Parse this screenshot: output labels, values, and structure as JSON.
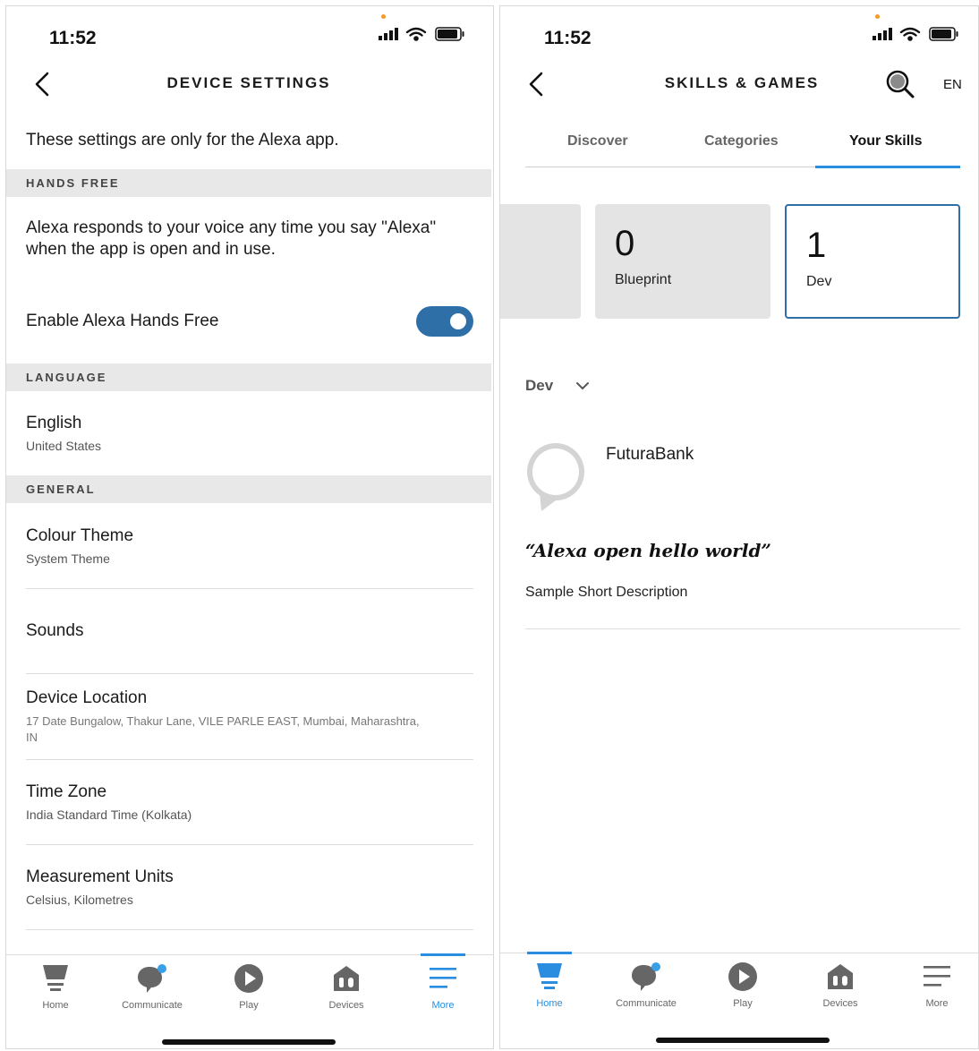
{
  "left": {
    "status": {
      "time": "11:52"
    },
    "header": {
      "title": "DEVICE SETTINGS"
    },
    "intro": "These settings are only for the Alexa app.",
    "hands_free": {
      "section": "HANDS FREE",
      "description": "Alexa responds to your voice any time you say \"Alexa\" when the app is open and in use.",
      "toggle_label": "Enable Alexa Hands Free",
      "toggle_on": true
    },
    "language": {
      "section": "LANGUAGE",
      "title": "English",
      "sub": "United States"
    },
    "general": {
      "section": "GENERAL",
      "items": [
        {
          "title": "Colour Theme",
          "sub": "System Theme"
        },
        {
          "title": "Sounds",
          "sub": ""
        },
        {
          "title": "Device Location",
          "sub": "17 Date Bungalow, Thakur Lane, VILE PARLE EAST, Mumbai, Maharashtra,",
          "sub2": "IN"
        },
        {
          "title": "Time Zone",
          "sub": "India Standard Time (Kolkata)"
        },
        {
          "title": "Measurement Units",
          "sub": "Celsius, Kilometres"
        }
      ]
    },
    "tabbar": [
      {
        "label": "Home",
        "icon": "home-icon"
      },
      {
        "label": "Communicate",
        "icon": "communicate-icon"
      },
      {
        "label": "Play",
        "icon": "play-icon"
      },
      {
        "label": "Devices",
        "icon": "devices-icon"
      },
      {
        "label": "More",
        "icon": "more-icon",
        "active": true
      }
    ]
  },
  "right": {
    "status": {
      "time": "11:52"
    },
    "header": {
      "title": "SKILLS & GAMES",
      "lang": "EN"
    },
    "tabs": [
      "Discover",
      "Categories",
      "Your Skills"
    ],
    "active_tab": "Your Skills",
    "cards": [
      {
        "count": "0",
        "label": "Blueprint"
      },
      {
        "count": "1",
        "label": "Dev",
        "selected": true
      }
    ],
    "filter": "Dev",
    "skill": {
      "name": "FuturaBank",
      "phrase": "“Alexa open hello world”",
      "description": "Sample Short Description"
    },
    "tabbar": [
      {
        "label": "Home",
        "icon": "home-icon",
        "active": true
      },
      {
        "label": "Communicate",
        "icon": "communicate-icon"
      },
      {
        "label": "Play",
        "icon": "play-icon"
      },
      {
        "label": "Devices",
        "icon": "devices-icon"
      },
      {
        "label": "More",
        "icon": "more-icon"
      }
    ]
  },
  "colors": {
    "accent": "#2a8de0",
    "toggle": "#2f6fa8",
    "band": "#e8e8e8"
  }
}
